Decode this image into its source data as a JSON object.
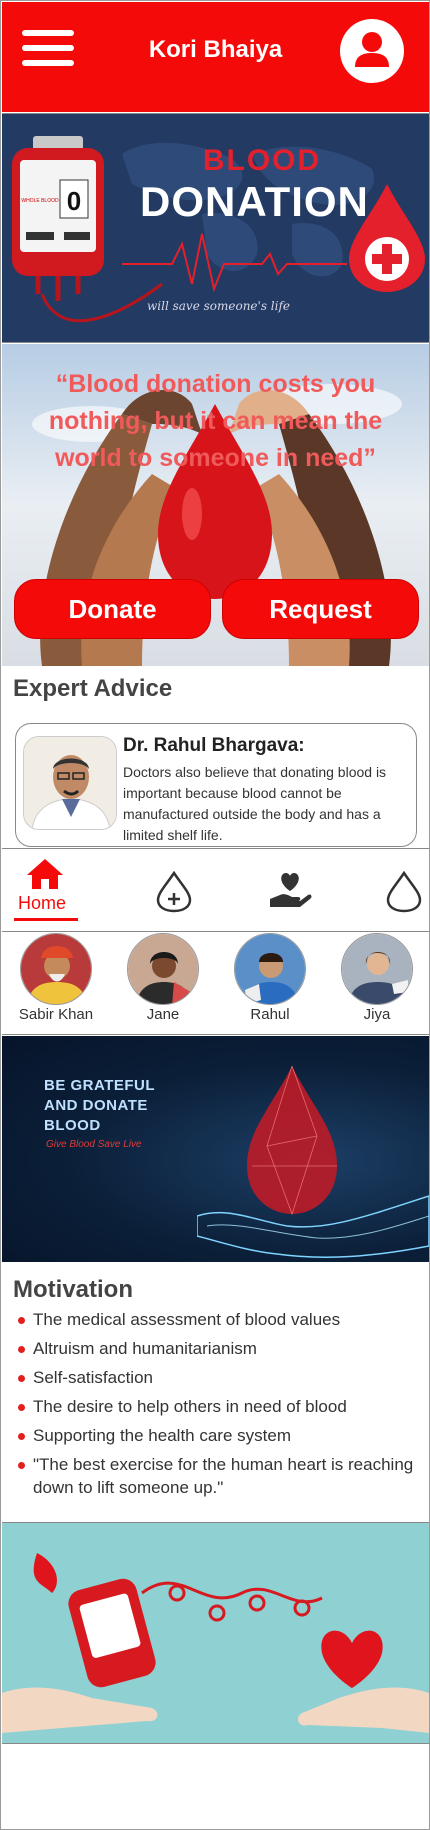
{
  "header": {
    "title": "Kori Bhaiya",
    "menu_icon": "hamburger-menu-icon",
    "profile_icon": "user-profile-icon",
    "bg_color": "#f50a0a"
  },
  "banner1": {
    "blood": "BLOOD",
    "donation": "DONATION",
    "tagline": "will save someone's life",
    "bag_count": "0",
    "bag_label": "WHOLE BLOOD"
  },
  "quote": {
    "text": "“Blood donation costs you nothing, but it can mean the world to someone in need”",
    "donate_label": "Donate",
    "request_label": "Request"
  },
  "expert": {
    "title": "Expert Advice",
    "name": "Dr. Rahul Bhargava:",
    "text": "Doctors also believe that donating blood is important because blood cannot be manufactured outside the body and has a limited shelf life."
  },
  "nav": {
    "home_label": "Home",
    "items": [
      "home-icon",
      "blood-drop-plus-icon",
      "heart-hand-icon",
      "blood-drop-icon"
    ]
  },
  "stories": [
    {
      "name": "Sabir Khan"
    },
    {
      "name": "Jane"
    },
    {
      "name": "Rahul"
    },
    {
      "name": "Jiya"
    }
  ],
  "banner2": {
    "line1": "BE GRATEFUL",
    "line2": "AND DONATE",
    "line3": "BLOOD",
    "sub": "Give Blood  Save Live"
  },
  "motivation": {
    "title": "Motivation",
    "items": [
      "The medical assessment of blood values",
      "Altruism and humanitarianism",
      "Self-satisfaction",
      "The desire to help others in need of blood",
      "Supporting the health care system",
      "\"The best exercise for the human heart is reaching down to lift someone up.\""
    ]
  },
  "colors": {
    "accent": "#f50a0a",
    "quote": "#f05a5a"
  }
}
